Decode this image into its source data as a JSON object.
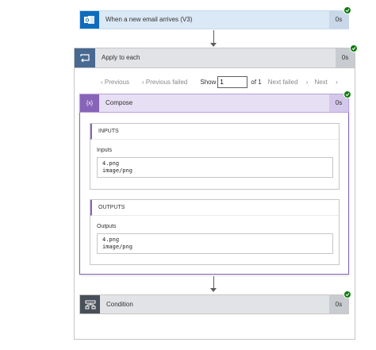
{
  "trigger": {
    "title": "When a new email arrives (V3)",
    "duration": "0s",
    "icon": "outlook-icon"
  },
  "loop": {
    "title": "Apply to each",
    "duration": "0s",
    "icon": "loop-icon",
    "pager": {
      "previous": "Previous",
      "previous_failed": "Previous failed",
      "show": "Show",
      "current": "1",
      "of": "of 1",
      "next_failed": "Next failed",
      "next": "Next"
    }
  },
  "compose": {
    "title": "Compose",
    "duration": "0s",
    "icon_glyph": "{x}",
    "inputs": {
      "header": "INPUTS",
      "label": "Inputs",
      "line1": "4.png",
      "line2": "image/png"
    },
    "outputs": {
      "header": "OUTPUTS",
      "label": "Outputs",
      "line1": "4.png",
      "line2": "image/png"
    }
  },
  "condition": {
    "title": "Condition",
    "duration": "0s",
    "icon": "condition-icon"
  },
  "colors": {
    "success": "#107c10",
    "trigger_accent": "#0f6cbd",
    "loop_accent": "#486991",
    "compose_accent": "#8764b8",
    "condition_accent": "#484f58"
  }
}
